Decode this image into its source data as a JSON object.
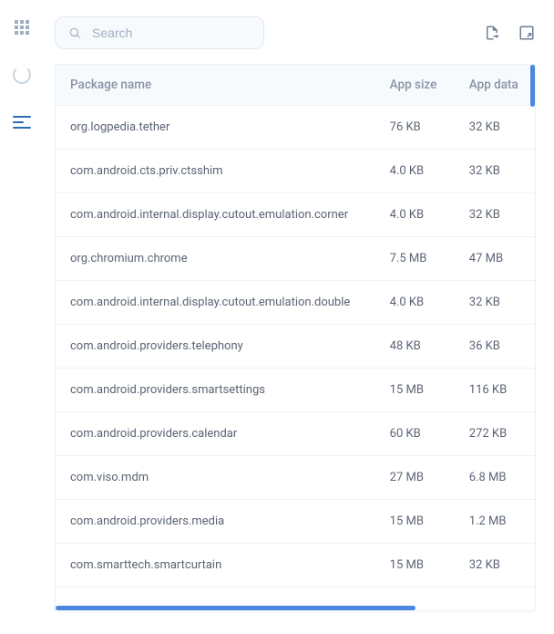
{
  "search": {
    "placeholder": "Search",
    "value": ""
  },
  "table": {
    "headers": {
      "name": "Package name",
      "size": "App size",
      "data": "App data"
    },
    "rows": [
      {
        "name": "org.logpedia.tether",
        "size": "76 KB",
        "data": "32 KB"
      },
      {
        "name": "com.android.cts.priv.ctsshim",
        "size": "4.0 KB",
        "data": "32 KB"
      },
      {
        "name": "com.android.internal.display.cutout.emulation.corner",
        "size": "4.0 KB",
        "data": "32 KB"
      },
      {
        "name": "org.chromium.chrome",
        "size": "7.5 MB",
        "data": "47 MB"
      },
      {
        "name": "com.android.internal.display.cutout.emulation.double",
        "size": "4.0 KB",
        "data": "32 KB"
      },
      {
        "name": "com.android.providers.telephony",
        "size": "48 KB",
        "data": "36 KB"
      },
      {
        "name": "com.android.providers.smartsettings",
        "size": "15 MB",
        "data": "116 KB"
      },
      {
        "name": "com.android.providers.calendar",
        "size": "60 KB",
        "data": "272 KB"
      },
      {
        "name": "com.viso.mdm",
        "size": "27 MB",
        "data": "6.8 MB"
      },
      {
        "name": "com.android.providers.media",
        "size": "15 MB",
        "data": "1.2 MB"
      },
      {
        "name": "com.smarttech.smartcurtain",
        "size": "15 MB",
        "data": "32 KB"
      }
    ]
  }
}
